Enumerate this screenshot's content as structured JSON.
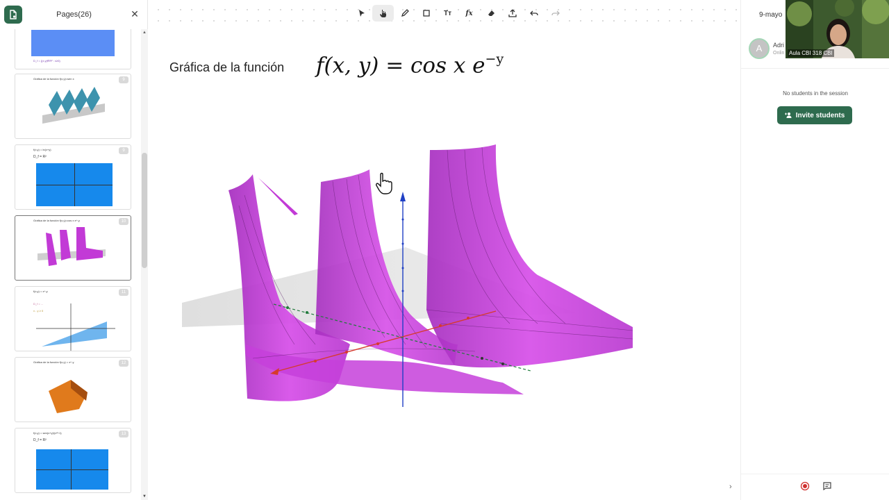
{
  "sidebar": {
    "title": "Pages(26)",
    "close_icon": "close-icon",
    "thumbnails": [
      {
        "num": "",
        "caption": "D_f = {(x,y)∈R² : x≥0}"
      },
      {
        "num": "9",
        "caption": "Gráfica de la función f(x,y)=sen x"
      },
      {
        "num": "9",
        "caption": "f(x,y) = ln(x+y)",
        "subcaption": "D_f = R²"
      },
      {
        "num": "10",
        "caption": "Gráfica de la función f(x,y)=cos x e^-y"
      },
      {
        "num": "11",
        "caption": "f(x,y) = x^-y"
      },
      {
        "num": "12",
        "caption": "Gráfica de la función f(x,y) = x^-y"
      },
      {
        "num": "13",
        "caption": "f(x,y) = sen(x+y)/(x²+1)",
        "subcaption": "D_f = R²"
      }
    ]
  },
  "toolbar": {
    "tools": [
      "select-arrow-icon",
      "hand-icon",
      "pen-icon",
      "rectangle-icon",
      "text-icon",
      "formula-icon",
      "eraser-icon",
      "upload-icon",
      "undo-icon",
      "redo-icon"
    ],
    "text_tool_label": "Tт",
    "formula_tool_label": "fx"
  },
  "slide": {
    "label": "Gráfica de la función",
    "formula_main": "f(x, y) = cos x e",
    "formula_exp": "−y"
  },
  "right_panel": {
    "date": "9-mayo",
    "participant": {
      "initial": "A",
      "name": "Adri",
      "status": "Onlin"
    },
    "no_students": "No students in the session",
    "invite_label": "Invite students",
    "video_label": "Aula CBI 318 CBI"
  },
  "colors": {
    "brand_green": "#2e6b4e",
    "surface_magenta": "#c23ad6",
    "record_red": "#d0302e"
  }
}
